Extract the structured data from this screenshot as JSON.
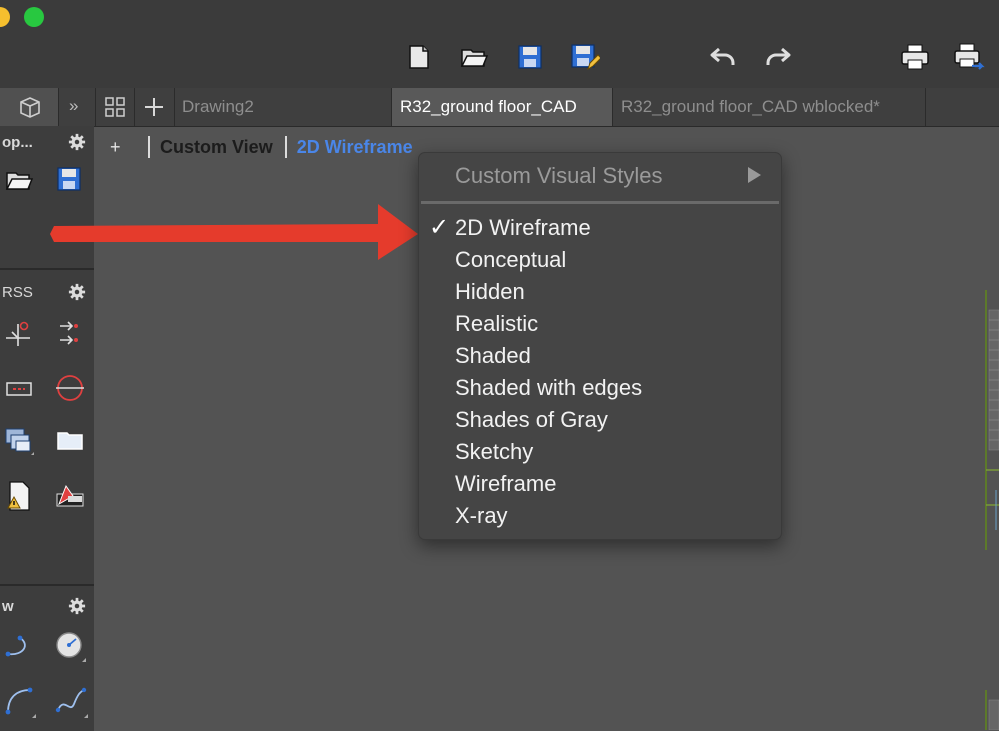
{
  "tabs": [
    {
      "label": "Drawing2",
      "active": false
    },
    {
      "label": "R32_ground floor_CAD",
      "active": true
    },
    {
      "label": "R32_ground floor_CAD wblocked*",
      "active": false
    }
  ],
  "sidebar": {
    "sections": [
      {
        "title": "op..."
      },
      {
        "title": "RSS"
      },
      {
        "title": "w"
      }
    ]
  },
  "viewbar": {
    "add_label": "+",
    "view_label": "Custom View",
    "style_label": "2D Wireframe"
  },
  "menu": {
    "submenu_label": "Custom Visual Styles",
    "items": [
      {
        "label": "2D Wireframe",
        "checked": true
      },
      {
        "label": "Conceptual"
      },
      {
        "label": "Hidden"
      },
      {
        "label": "Realistic"
      },
      {
        "label": "Shaded"
      },
      {
        "label": "Shaded with edges"
      },
      {
        "label": "Shades of Gray"
      },
      {
        "label": "Sketchy"
      },
      {
        "label": "Wireframe"
      },
      {
        "label": "X-ray"
      }
    ],
    "check_glyph": "✓"
  },
  "colors": {
    "accent_blue": "#4a86e8",
    "annotation_red": "#e53b2c"
  }
}
